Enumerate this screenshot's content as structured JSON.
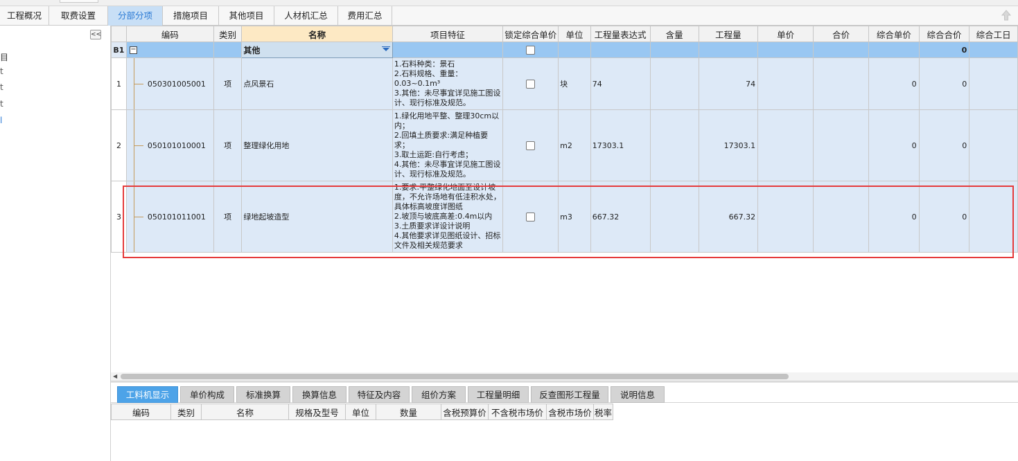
{
  "main_tabs": [
    {
      "label": "工程概况"
    },
    {
      "label": "取费设置"
    },
    {
      "label": "分部分项"
    },
    {
      "label": "措施项目"
    },
    {
      "label": "其他项目"
    },
    {
      "label": "人材机汇总"
    },
    {
      "label": "费用汇总"
    }
  ],
  "active_tab": "分部分项",
  "left_panel": {
    "collapse_label": "<<",
    "items": [
      "目",
      "t",
      "t",
      "t",
      "l"
    ]
  },
  "grid": {
    "columns": [
      "编码",
      "类别",
      "名称",
      "项目特征",
      "锁定综合单价",
      "单位",
      "工程量表达式",
      "含量",
      "工程量",
      "单价",
      "合价",
      "综合单价",
      "综合合价",
      "综合工日"
    ],
    "group_row": {
      "line": "B1",
      "name": "其他",
      "total": "0"
    },
    "rows": [
      {
        "line": "1",
        "code": "050301005001",
        "category": "项",
        "name": "点风景石",
        "features": "1.石料种类：景石\n2.石料规格、重量：0.03~0.1m³\n3.其他：未尽事宜详见施工图设计、现行标准及规范。",
        "unit": "块",
        "expression": "74",
        "quantity": "74",
        "unit_price_total": "0",
        "total_price": "0"
      },
      {
        "line": "2",
        "code": "050101010001",
        "category": "项",
        "name": "整理绿化用地",
        "features": "1.绿化用地平整、整理30cm以内；\n2.回填土质要求:满足种植要求；\n3.取土运距:自行考虑；\n4.其他：未尽事宜详见施工图设计、现行标准及规范。",
        "unit": "m2",
        "expression": "17303.1",
        "quantity": "17303.1",
        "unit_price_total": "0",
        "total_price": "0"
      },
      {
        "line": "3",
        "code": "050101011001",
        "category": "项",
        "name": "绿地起坡造型",
        "features": "1.要求:平整绿化地面至设计坡度，不允许场地有低洼积水处，具体标高坡度详图纸\n2.坡顶与坡底高差:0.4m以内\n3.土质要求详设计说明\n4.其他要求详见图纸设计、招标文件及相关规范要求",
        "unit": "m3",
        "expression": "667.32",
        "quantity": "667.32",
        "unit_price_total": "0",
        "total_price": "0"
      }
    ]
  },
  "bottom_tabs": [
    {
      "label": "工料机显示"
    },
    {
      "label": "单价构成"
    },
    {
      "label": "标准换算"
    },
    {
      "label": "换算信息"
    },
    {
      "label": "特征及内容"
    },
    {
      "label": "组价方案"
    },
    {
      "label": "工程量明细"
    },
    {
      "label": "反查图形工程量"
    },
    {
      "label": "说明信息"
    }
  ],
  "bottom_grid": {
    "columns": [
      "编码",
      "类别",
      "名称",
      "规格及型号",
      "单位",
      "数量",
      "含税预算价",
      "不含税市场价",
      "含税市场价",
      "税率"
    ]
  },
  "colors": {
    "accent": "#4da3e8",
    "highlight_box": "#e53a3a",
    "group_row": "#99c7f2"
  }
}
